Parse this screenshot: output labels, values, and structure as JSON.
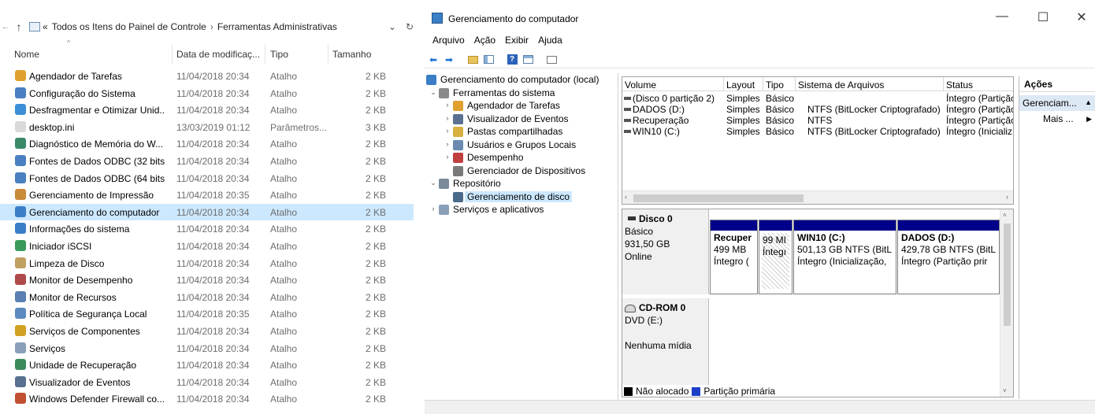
{
  "explorer": {
    "address": {
      "back": "←",
      "forward": "→",
      "up": "↑",
      "prefix": "«",
      "crumbs": [
        "Todos os Itens do Painel de Controle",
        "Ferramentas Administrativas"
      ],
      "separator": "›",
      "dropdown": "⌄",
      "refresh": "↻"
    },
    "columns": {
      "name": "Nome",
      "date": "Data de modificaç...",
      "type": "Tipo",
      "size": "Tamanho",
      "sort_indicator": "^"
    },
    "files": [
      {
        "name": "Agendador de Tarefas",
        "date": "11/04/2018 20:34",
        "type": "Atalho",
        "size": "2 KB",
        "icon": "task-scheduler-icon",
        "color": "#e0a030"
      },
      {
        "name": "Configuração do Sistema",
        "date": "11/04/2018 20:34",
        "type": "Atalho",
        "size": "2 KB",
        "icon": "system-config-icon",
        "color": "#4a7fc1"
      },
      {
        "name": "Desfragmentar e Otimizar Unid...",
        "date": "11/04/2018 20:34",
        "type": "Atalho",
        "size": "2 KB",
        "icon": "defrag-icon",
        "color": "#3d8fd6"
      },
      {
        "name": "desktop.ini",
        "date": "13/03/2019 01:12",
        "type": "Parâmetros...",
        "size": "3 KB",
        "icon": "ini-file-icon",
        "color": "#d9d9d9"
      },
      {
        "name": "Diagnóstico de Memória do W...",
        "date": "11/04/2018 20:34",
        "type": "Atalho",
        "size": "2 KB",
        "icon": "memory-diagnostic-icon",
        "color": "#3a8a6a"
      },
      {
        "name": "Fontes de Dados ODBC (32 bits)",
        "date": "11/04/2018 20:34",
        "type": "Atalho",
        "size": "2 KB",
        "icon": "odbc-icon",
        "color": "#4a7fc1"
      },
      {
        "name": "Fontes de Dados ODBC (64 bits)",
        "date": "11/04/2018 20:34",
        "type": "Atalho",
        "size": "2 KB",
        "icon": "odbc-icon",
        "color": "#4a7fc1"
      },
      {
        "name": "Gerenciamento de Impressão",
        "date": "11/04/2018 20:35",
        "type": "Atalho",
        "size": "2 KB",
        "icon": "print-management-icon",
        "color": "#c98a3a"
      },
      {
        "name": "Gerenciamento do computador",
        "date": "11/04/2018 20:34",
        "type": "Atalho",
        "size": "2 KB",
        "icon": "computer-management-icon",
        "color": "#3a7ec7",
        "selected": true
      },
      {
        "name": "Informações do sistema",
        "date": "11/04/2018 20:34",
        "type": "Atalho",
        "size": "2 KB",
        "icon": "system-info-icon",
        "color": "#3a7ec7"
      },
      {
        "name": "Iniciador iSCSI",
        "date": "11/04/2018 20:34",
        "type": "Atalho",
        "size": "2 KB",
        "icon": "iscsi-icon",
        "color": "#3a9a5a"
      },
      {
        "name": "Limpeza de Disco",
        "date": "11/04/2018 20:34",
        "type": "Atalho",
        "size": "2 KB",
        "icon": "disk-cleanup-icon",
        "color": "#c0a060"
      },
      {
        "name": "Monitor de Desempenho",
        "date": "11/04/2018 20:34",
        "type": "Atalho",
        "size": "2 KB",
        "icon": "performance-monitor-icon",
        "color": "#b04a4a"
      },
      {
        "name": "Monitor de Recursos",
        "date": "11/04/2018 20:34",
        "type": "Atalho",
        "size": "2 KB",
        "icon": "resource-monitor-icon",
        "color": "#5a7fb0"
      },
      {
        "name": "Política de Segurança Local",
        "date": "11/04/2018 20:35",
        "type": "Atalho",
        "size": "2 KB",
        "icon": "security-policy-icon",
        "color": "#5a8ac0"
      },
      {
        "name": "Serviços de Componentes",
        "date": "11/04/2018 20:34",
        "type": "Atalho",
        "size": "2 KB",
        "icon": "component-services-icon",
        "color": "#d0a020"
      },
      {
        "name": "Serviços",
        "date": "11/04/2018 20:34",
        "type": "Atalho",
        "size": "2 KB",
        "icon": "services-icon",
        "color": "#8aa0b8"
      },
      {
        "name": "Unidade de Recuperação",
        "date": "11/04/2018 20:34",
        "type": "Atalho",
        "size": "2 KB",
        "icon": "recovery-drive-icon",
        "color": "#3a8a5a"
      },
      {
        "name": "Visualizador de Eventos",
        "date": "11/04/2018 20:34",
        "type": "Atalho",
        "size": "2 KB",
        "icon": "event-viewer-icon",
        "color": "#5a7090"
      },
      {
        "name": "Windows Defender Firewall co...",
        "date": "11/04/2018 20:34",
        "type": "Atalho",
        "size": "2 KB",
        "icon": "firewall-icon",
        "color": "#c05030"
      }
    ]
  },
  "cm": {
    "title": "Gerenciamento do computador",
    "caption": {
      "minimize": "—",
      "maximize": "☐",
      "close": "✕"
    },
    "menu": [
      "Arquivo",
      "Ação",
      "Exibir",
      "Ajuda"
    ],
    "toolbar": [
      "back-icon",
      "forward-icon",
      "up-folder-icon",
      "show-hide-tree-icon",
      "help-icon",
      "properties-icon",
      "console-view-icon"
    ],
    "tree": [
      {
        "label": "Gerenciamento do computador (local)",
        "level": 0,
        "exp": "",
        "icon": "computer-management-icon",
        "color": "#3a7ec7"
      },
      {
        "label": "Ferramentas do sistema",
        "level": 1,
        "exp": "⌄",
        "icon": "system-tools-icon",
        "color": "#8a8a8a"
      },
      {
        "label": "Agendador de Tarefas",
        "level": 2,
        "exp": "›",
        "icon": "task-scheduler-icon",
        "color": "#e0a030"
      },
      {
        "label": "Visualizador de Eventos",
        "level": 2,
        "exp": "›",
        "icon": "event-viewer-icon",
        "color": "#5a7090"
      },
      {
        "label": "Pastas compartilhadas",
        "level": 2,
        "exp": "›",
        "icon": "shared-folders-icon",
        "color": "#d8b040"
      },
      {
        "label": "Usuários e Grupos Locais",
        "level": 2,
        "exp": "›",
        "icon": "users-groups-icon",
        "color": "#6a8ab0"
      },
      {
        "label": "Desempenho",
        "level": 2,
        "exp": "›",
        "icon": "performance-icon",
        "color": "#c04040"
      },
      {
        "label": "Gerenciador de Dispositivos",
        "level": 2,
        "exp": "",
        "icon": "device-manager-icon",
        "color": "#7a7a7a"
      },
      {
        "label": "Repositório",
        "level": 1,
        "exp": "⌄",
        "icon": "storage-icon",
        "color": "#7a8a9a"
      },
      {
        "label": "Gerenciamento de disco",
        "level": 2,
        "exp": "",
        "icon": "disk-management-icon",
        "color": "#4a6a8a",
        "selected": true
      },
      {
        "label": "Serviços e aplicativos",
        "level": 1,
        "exp": "›",
        "icon": "services-apps-icon",
        "color": "#8aa0b8"
      }
    ],
    "volumes": {
      "headers": [
        "Volume",
        "Layout",
        "Tipo",
        "Sistema de Arquivos",
        "Status"
      ],
      "rows": [
        [
          "(Disco 0 partição 2)",
          "Simples",
          "Básico",
          "",
          "Íntegro (Partiçãc"
        ],
        [
          "DADOS (D:)",
          "Simples",
          "Básico",
          "NTFS (BitLocker Criptografado)",
          "Íntegro (Partiçãc"
        ],
        [
          "Recuperação",
          "Simples",
          "Básico",
          "NTFS",
          "Íntegro (Partiçãc"
        ],
        [
          "WIN10 (C:)",
          "Simples",
          "Básico",
          "NTFS (BitLocker Criptografado)",
          "Íntegro (Inicializ"
        ]
      ],
      "scroll_left": "‹",
      "scroll_right": "›"
    },
    "disk0": {
      "name": "Disco 0",
      "type": "Básico",
      "size": "931,50 GB",
      "status": "Online",
      "partitions": [
        {
          "name": "Recuper",
          "line1": "499 MB",
          "line2": "Íntegro (",
          "hatch": false
        },
        {
          "name": "",
          "line1": "99 MI",
          "line2": "Íntegı",
          "hatch": true
        },
        {
          "name": "WIN10  (C:)",
          "line1": "501,13 GB NTFS (BitL",
          "line2": "Íntegro (Inicialização,",
          "hatch": false
        },
        {
          "name": "DADOS  (D:)",
          "line1": "429,78 GB NTFS (BitL",
          "line2": "Íntegro (Partição prir",
          "hatch": false
        }
      ]
    },
    "cdrom": {
      "name": "CD-ROM 0",
      "drive": "DVD (E:)",
      "status": "Nenhuma mídia"
    },
    "disk_scroll": {
      "up": "˄",
      "down": "˅"
    },
    "legend": [
      {
        "label": "Não alocado",
        "color": "#000000"
      },
      {
        "label": "Partição primária",
        "color": "#1c3fc8"
      }
    ],
    "actions": {
      "header": "Ações",
      "group": "Gerenciam...",
      "group_arrow": "▲",
      "more": "Mais ...",
      "more_arrow": "▶"
    }
  }
}
